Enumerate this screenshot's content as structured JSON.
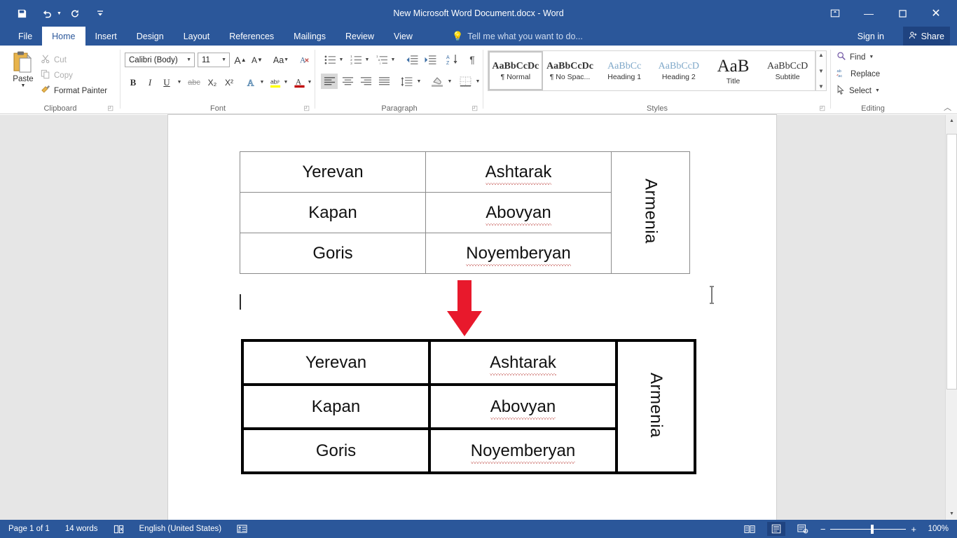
{
  "titlebar": {
    "document_title": "New Microsoft Word Document.docx - Word",
    "quick_access": [
      {
        "name": "save",
        "icon": "save-icon"
      },
      {
        "name": "undo",
        "icon": "undo-icon"
      },
      {
        "name": "redo",
        "icon": "redo-icon"
      },
      {
        "name": "customize-quick-access-toolbar",
        "icon": "chevron-down-icon"
      }
    ],
    "window_controls": {
      "ribbon_display_options": "⊡",
      "minimize": "—",
      "restore": "❐",
      "close": "✕"
    }
  },
  "tabs": [
    {
      "label": "File",
      "active": false
    },
    {
      "label": "Home",
      "active": true
    },
    {
      "label": "Insert",
      "active": false
    },
    {
      "label": "Design",
      "active": false
    },
    {
      "label": "Layout",
      "active": false
    },
    {
      "label": "References",
      "active": false
    },
    {
      "label": "Mailings",
      "active": false
    },
    {
      "label": "Review",
      "active": false
    },
    {
      "label": "View",
      "active": false
    }
  ],
  "tellme": {
    "placeholder": "Tell me what you want to do..."
  },
  "account": {
    "signin": "Sign in",
    "share": "Share"
  },
  "ribbon": {
    "clipboard": {
      "group_label": "Clipboard",
      "paste_label": "Paste",
      "cut_label": "Cut",
      "copy_label": "Copy",
      "format_painter_label": "Format Painter"
    },
    "font": {
      "group_label": "Font",
      "font_name": "Calibri (Body)",
      "font_size": "11",
      "grow_font": "A",
      "shrink_font": "A",
      "change_case": "Aa",
      "clear_formatting": "clear-formatting-icon",
      "bold": "B",
      "italic": "I",
      "underline": "U",
      "strikethrough": "abc",
      "subscript": "X₂",
      "superscript": "X²",
      "text_effects": "A",
      "text_highlight": "ab",
      "font_color": "A"
    },
    "paragraph": {
      "group_label": "Paragraph",
      "bullets": "bullets-icon",
      "numbering": "numbering-icon",
      "multilevel_list": "multilevel-list-icon",
      "decrease_indent": "decrease-indent-icon",
      "increase_indent": "increase-indent-icon",
      "sort": "sort-icon",
      "show_marks": "¶",
      "align_left": "align-left-icon",
      "align_center": "align-center-icon",
      "align_right": "align-right-icon",
      "justify": "justify-icon",
      "line_spacing": "line-spacing-icon",
      "shading": "shading-icon",
      "borders": "borders-icon"
    },
    "styles": {
      "group_label": "Styles",
      "items": [
        {
          "preview": "AaBbCcDc",
          "name": "¶ Normal",
          "selected": true
        },
        {
          "preview": "AaBbCcDc",
          "name": "¶ No Spac...",
          "selected": false
        },
        {
          "preview": "AaBbCc",
          "name": "Heading 1",
          "selected": false
        },
        {
          "preview": "AaBbCcD",
          "name": "Heading 2",
          "selected": false
        },
        {
          "preview": "AaB",
          "name": "Title",
          "selected": false
        },
        {
          "preview": "AaBbCcD",
          "name": "Subtitle",
          "selected": false
        }
      ]
    },
    "editing": {
      "group_label": "Editing",
      "find_label": "Find",
      "replace_label": "Replace",
      "select_label": "Select"
    }
  },
  "document": {
    "table_top": {
      "border_style": "thin-gray",
      "rows": [
        [
          "Yerevan",
          "Ashtarak"
        ],
        [
          "Kapan",
          "Abovyan"
        ],
        [
          "Goris",
          "Noyemberyan"
        ]
      ],
      "merged_column_label": "Armenia",
      "spellcheck_underlined": [
        "Ashtarak",
        "Abovyan",
        "Noyemberyan"
      ]
    },
    "table_bottom": {
      "border_style": "thick-black",
      "rows": [
        [
          "Yerevan",
          "Ashtarak"
        ],
        [
          "Kapan",
          "Abovyan"
        ],
        [
          "Goris",
          "Noyemberyan"
        ]
      ],
      "merged_column_label": "Armenia",
      "spellcheck_underlined": [
        "Ashtarak",
        "Abovyan",
        "Noyemberyan"
      ]
    },
    "arrow": {
      "direction": "down",
      "color": "#e8192c"
    }
  },
  "statusbar": {
    "page": "Page 1 of 1",
    "words": "14 words",
    "proofing_icon": "spellcheck-icon",
    "language": "English (United States)",
    "macro_icon": "macro-record-icon",
    "views": [
      {
        "name": "read-mode",
        "icon": "read-mode-icon",
        "active": false
      },
      {
        "name": "print-layout",
        "icon": "print-layout-icon",
        "active": true
      },
      {
        "name": "web-layout",
        "icon": "web-layout-icon",
        "active": false
      }
    ],
    "zoom_out": "−",
    "zoom_in": "+",
    "zoom_value": "100%"
  },
  "colors": {
    "word_blue": "#2b579a",
    "ribbon_bg": "#ffffff",
    "arrow_red": "#e8192c",
    "spell_underline": "#c0504d"
  }
}
